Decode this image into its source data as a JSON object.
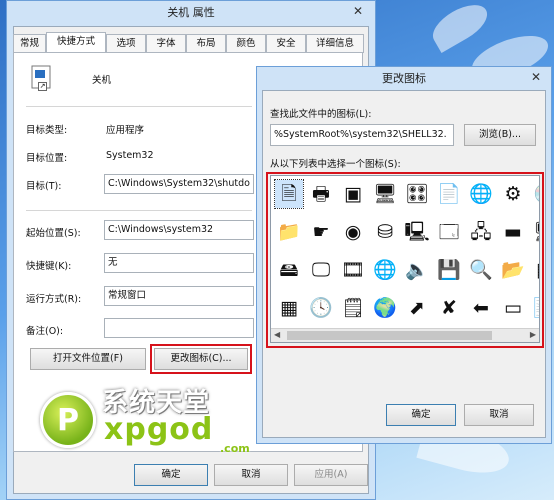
{
  "props": {
    "title": "关机 属性",
    "close_glyph": "✕",
    "tabs": [
      {
        "label": "常规"
      },
      {
        "label": "快捷方式"
      },
      {
        "label": "选项"
      },
      {
        "label": "字体"
      },
      {
        "label": "布局"
      },
      {
        "label": "颜色"
      },
      {
        "label": "安全"
      },
      {
        "label": "详细信息"
      }
    ],
    "shortcut_name": "关机",
    "target_type_label": "目标类型:",
    "target_type_value": "应用程序",
    "target_location_label": "目标位置:",
    "target_location_value": "System32",
    "target_label": "目标(T):",
    "target_value": "C:\\Windows\\System32\\shutdo",
    "start_in_label": "起始位置(S):",
    "start_in_value": "C:\\Windows\\system32",
    "hotkey_label": "快捷键(K):",
    "hotkey_value": "无",
    "run_label": "运行方式(R):",
    "run_value": "常规窗口",
    "comment_label": "备注(O):",
    "comment_value": "",
    "open_location_button": "打开文件位置(F)",
    "change_icon_button": "更改图标(C)...",
    "ok_button": "确定",
    "cancel_button": "取消",
    "apply_button": "应用(A)"
  },
  "icon_dialog": {
    "title": "更改图标",
    "close_glyph": "✕",
    "find_label": "查找此文件中的图标(L):",
    "path_value": "%SystemRoot%\\system32\\SHELL32.",
    "browse_button": "浏览(B)...",
    "select_label": "从以下列表中选择一个图标(S):",
    "ok_button": "确定",
    "cancel_button": "取消",
    "icons": [
      {
        "name": "document-page-icon",
        "glyph": "🗎"
      },
      {
        "name": "folder-icon",
        "glyph": "📁"
      },
      {
        "name": "drive-icon",
        "glyph": "🖴"
      },
      {
        "name": "chip-icon",
        "glyph": "▦"
      },
      {
        "name": "printer-icon",
        "glyph": "🖶"
      },
      {
        "name": "hand-icon",
        "glyph": "☛"
      },
      {
        "name": "window-cd-icon",
        "glyph": "🖵"
      },
      {
        "name": "clock-document-icon",
        "glyph": "🕓"
      },
      {
        "name": "blue-window-icon",
        "glyph": "▣"
      },
      {
        "name": "disc-icon",
        "glyph": "◉"
      },
      {
        "name": "film-icon",
        "glyph": "🎞"
      },
      {
        "name": "text-document-icon",
        "glyph": "🗒"
      },
      {
        "name": "server-icon",
        "glyph": "🖥"
      },
      {
        "name": "network-drive-icon",
        "glyph": "⛁"
      },
      {
        "name": "globe-icon",
        "glyph": "🌐"
      },
      {
        "name": "network-globe-icon",
        "glyph": "🌍"
      },
      {
        "name": "control-panel-icon",
        "glyph": "🎛"
      },
      {
        "name": "monitor-icon",
        "glyph": "🖳"
      },
      {
        "name": "speaker-icon",
        "glyph": "🔈"
      },
      {
        "name": "shortcut-icon",
        "glyph": "⬈"
      },
      {
        "name": "warning-document-icon",
        "glyph": "📄"
      },
      {
        "name": "window-icon",
        "glyph": "🗔"
      },
      {
        "name": "floppy-disk-icon",
        "glyph": "💾"
      },
      {
        "name": "disconnected-drive-icon",
        "glyph": "✘"
      },
      {
        "name": "globe-cursor-icon",
        "glyph": "🌐"
      },
      {
        "name": "network-icon",
        "glyph": "🖧"
      },
      {
        "name": "search-icon",
        "glyph": "🔍"
      },
      {
        "name": "green-arrow-icon",
        "glyph": "⬅"
      },
      {
        "name": "gear-icon",
        "glyph": "⚙"
      },
      {
        "name": "blue-screen-icon",
        "glyph": "▬"
      },
      {
        "name": "folder-2-icon",
        "glyph": "📂"
      },
      {
        "name": "flat-drive-icon",
        "glyph": "▭"
      },
      {
        "name": "cd-drive-icon",
        "glyph": "💿"
      },
      {
        "name": "computer-network-icon",
        "glyph": "🖥"
      },
      {
        "name": "grid-icon",
        "glyph": "▦"
      },
      {
        "name": "note-icon",
        "glyph": "📝"
      },
      {
        "name": "help-icon",
        "glyph": "?"
      },
      {
        "name": "power-icon",
        "glyph": "⏻"
      },
      {
        "name": "clipboard-icon",
        "glyph": "📋"
      },
      {
        "name": "recycle-bin-icon",
        "glyph": "🗑"
      },
      {
        "name": "recycle-full-icon",
        "glyph": "🗑"
      }
    ]
  },
  "watermark": {
    "title": "系统天堂",
    "brand": "xpgod",
    "suffix": ".com",
    "badge_glyph": "P"
  },
  "colors": {
    "highlight_box": "#d6121b",
    "brand_green": "#8cc316"
  }
}
